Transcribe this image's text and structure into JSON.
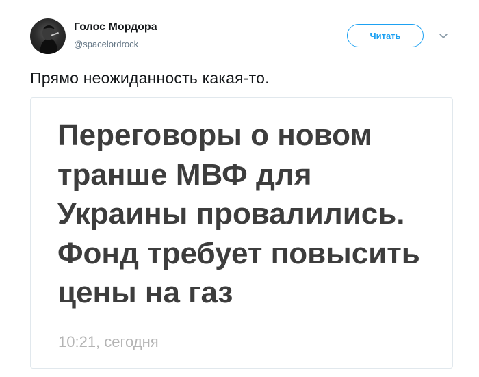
{
  "tweet": {
    "author_name": "Голос Мордора",
    "author_handle": "@spacelordrock",
    "follow_label": "Читать",
    "text": "Прямо неожиданность какая-то."
  },
  "card": {
    "headline": "Переговоры о новом транше МВФ для Украины провалились. Фонд требует повысить цены на газ",
    "timestamp": "10:21, сегодня"
  },
  "icons": {
    "avatar": "user-avatar",
    "menu": "chevron-down-icon"
  },
  "colors": {
    "accent": "#1da1f2",
    "headline": "#3d3d3d",
    "timestamp": "#b4b4b4"
  }
}
